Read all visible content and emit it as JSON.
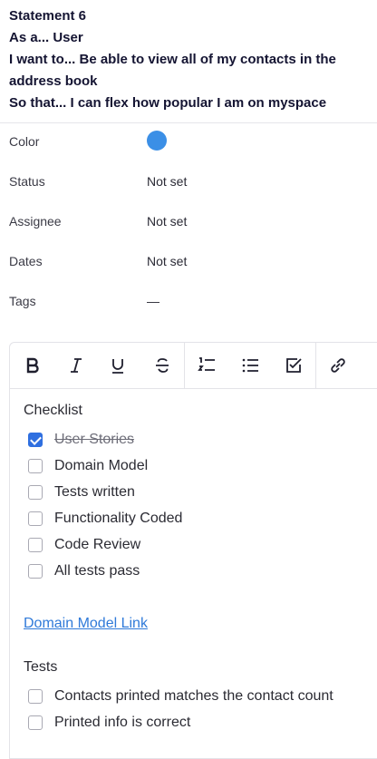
{
  "statement": {
    "title": "Statement 6",
    "as_a": "As a... User",
    "i_want": "I want to... Be able to view all of my contacts in the address book",
    "so_that": "So that... I can flex how popular I am on myspace"
  },
  "properties": {
    "color": {
      "label": "Color",
      "value_color": "#3b8fe6"
    },
    "status": {
      "label": "Status",
      "value": "Not set"
    },
    "assignee": {
      "label": "Assignee",
      "value": "Not set"
    },
    "dates": {
      "label": "Dates",
      "value": "Not set"
    },
    "tags": {
      "label": "Tags",
      "value": "—"
    }
  },
  "toolbar": {
    "buttons": [
      "bold-icon",
      "italic-icon",
      "underline-icon",
      "strikethrough-icon",
      "numbered-list-icon",
      "bullet-list-icon",
      "checklist-icon",
      "link-icon"
    ]
  },
  "editor": {
    "checklist_heading": "Checklist",
    "checklist": [
      {
        "label": "User Stories",
        "checked": true
      },
      {
        "label": "Domain Model",
        "checked": false
      },
      {
        "label": "Tests written",
        "checked": false
      },
      {
        "label": "Functionality Coded",
        "checked": false
      },
      {
        "label": "Code Review",
        "checked": false
      },
      {
        "label": "All tests pass",
        "checked": false
      }
    ],
    "link_text": "Domain Model Link",
    "tests_heading": "Tests",
    "tests": [
      {
        "label": "Contacts printed matches the contact count",
        "checked": false
      },
      {
        "label": "Printed info is correct",
        "checked": false
      }
    ]
  }
}
